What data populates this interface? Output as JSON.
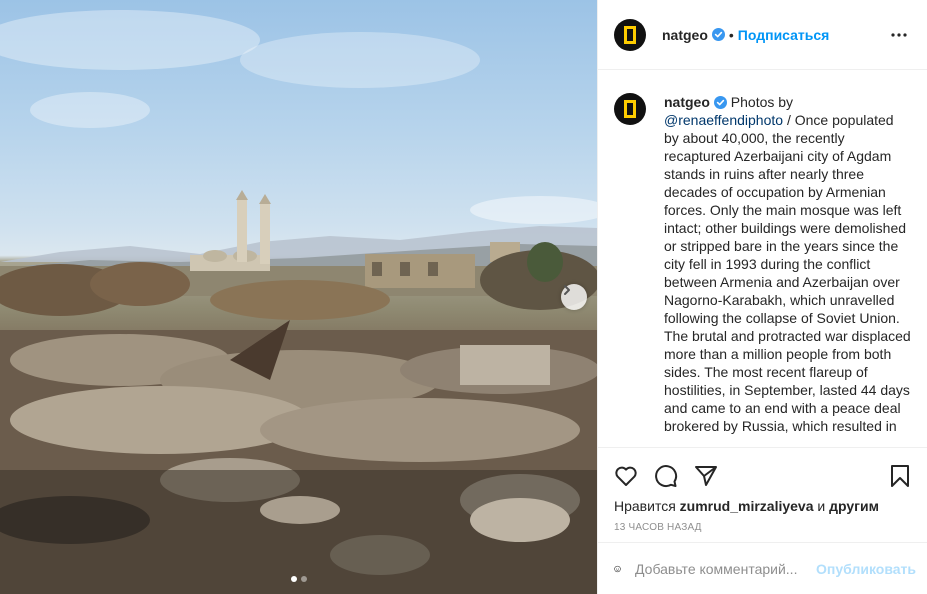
{
  "post": {
    "photo_alt": "Ruins of Agdam with the main mosque in the distance"
  },
  "header": {
    "username": "natgeo",
    "separator": "•",
    "follow_label": "Подписаться",
    "more_icon": "more-horizontal-icon"
  },
  "caption": {
    "username": "natgeo",
    "text_before": " Photos by ",
    "mention": "@renaeffendiphoto",
    "text_after": " / Once populated by about 40,000, the recently recaptured Azerbaijani city of Agdam stands in ruins after nearly three decades of occupation by Armenian forces. Only the main mosque was left intact; other buildings were demolished or stripped bare in the years since the city fell in 1993 during the conflict between Armenia and Azerbaijan over Nagorno-Karabakh, which unravelled following the collapse of Soviet Union. The brutal and protracted war displaced more than a million people from both sides. The most recent flareup of hostilities, in September, lasted 44 days and came to an end with a peace deal brokered by Russia, which resulted in"
  },
  "likes": {
    "prefix": "Нравится ",
    "user": "zumrud_mirzaliyeva",
    "middle": " и ",
    "suffix": "другим"
  },
  "timestamp": "13 часов назад",
  "comment": {
    "placeholder": "Добавьте комментарий...",
    "publish_label": "Опубликовать"
  },
  "colors": {
    "accent": "#0095f6",
    "brand_yellow": "#ffcd00",
    "publish_disabled": "#b2dffc"
  },
  "carousel": {
    "total": 2,
    "active": 1
  }
}
